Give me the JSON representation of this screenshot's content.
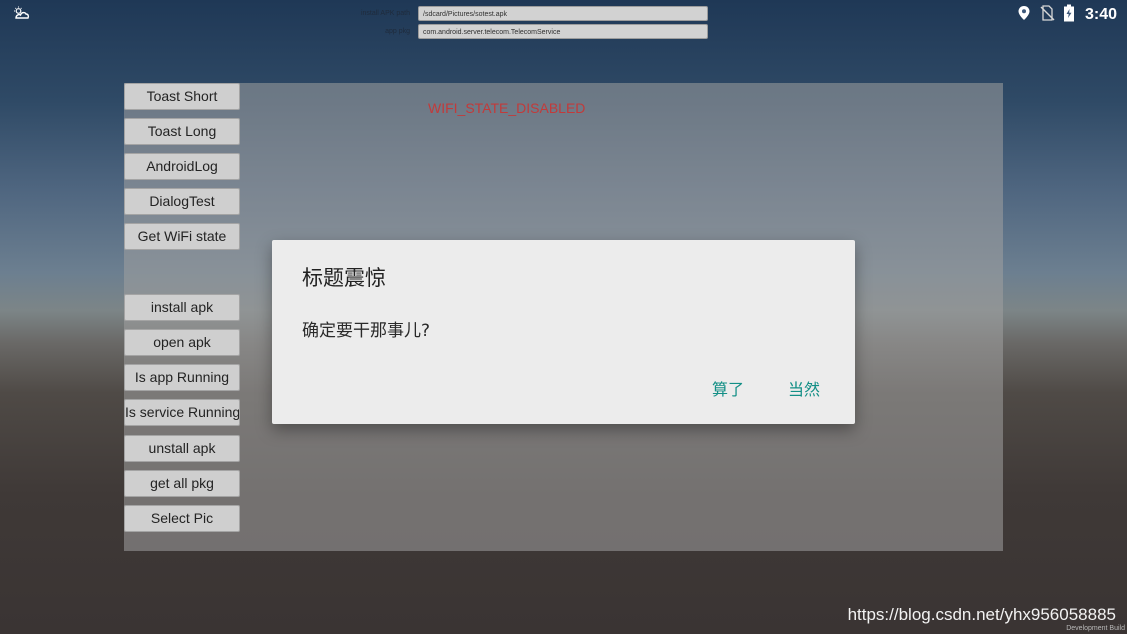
{
  "status_bar": {
    "time": "3:40",
    "icons": [
      "cloud-sun-icon",
      "location-icon",
      "no-sim-icon",
      "battery-charging-icon"
    ]
  },
  "top_fields": {
    "path_label": "install APK path",
    "path_value": "/sdcard/Pictures/sotest.apk",
    "pkg_label": "app pkg",
    "pkg_value": "com.android.server.telecom.TelecomService"
  },
  "panel": {
    "wifi_state": "WIFI_STATE_DISABLED"
  },
  "buttons": {
    "toast_short": "Toast Short",
    "toast_long": "Toast Long",
    "android_log": "AndroidLog",
    "dialog_test": "DialogTest",
    "get_wifi_state": "Get WiFi state",
    "install_apk": "install apk",
    "open_apk": "open apk",
    "is_app_running": "Is app Running",
    "is_service_running": "Is service Running",
    "unstall_apk": "unstall apk",
    "get_all_pkg": "get all pkg",
    "select_pic": "Select Pic"
  },
  "dialog": {
    "title": "标题震惊",
    "message": "确定要干那事儿?",
    "cancel_label": "算了",
    "ok_label": "当然"
  },
  "watermark": {
    "url": "https://blog.csdn.net/yhx956058885",
    "build": "Development Build"
  }
}
